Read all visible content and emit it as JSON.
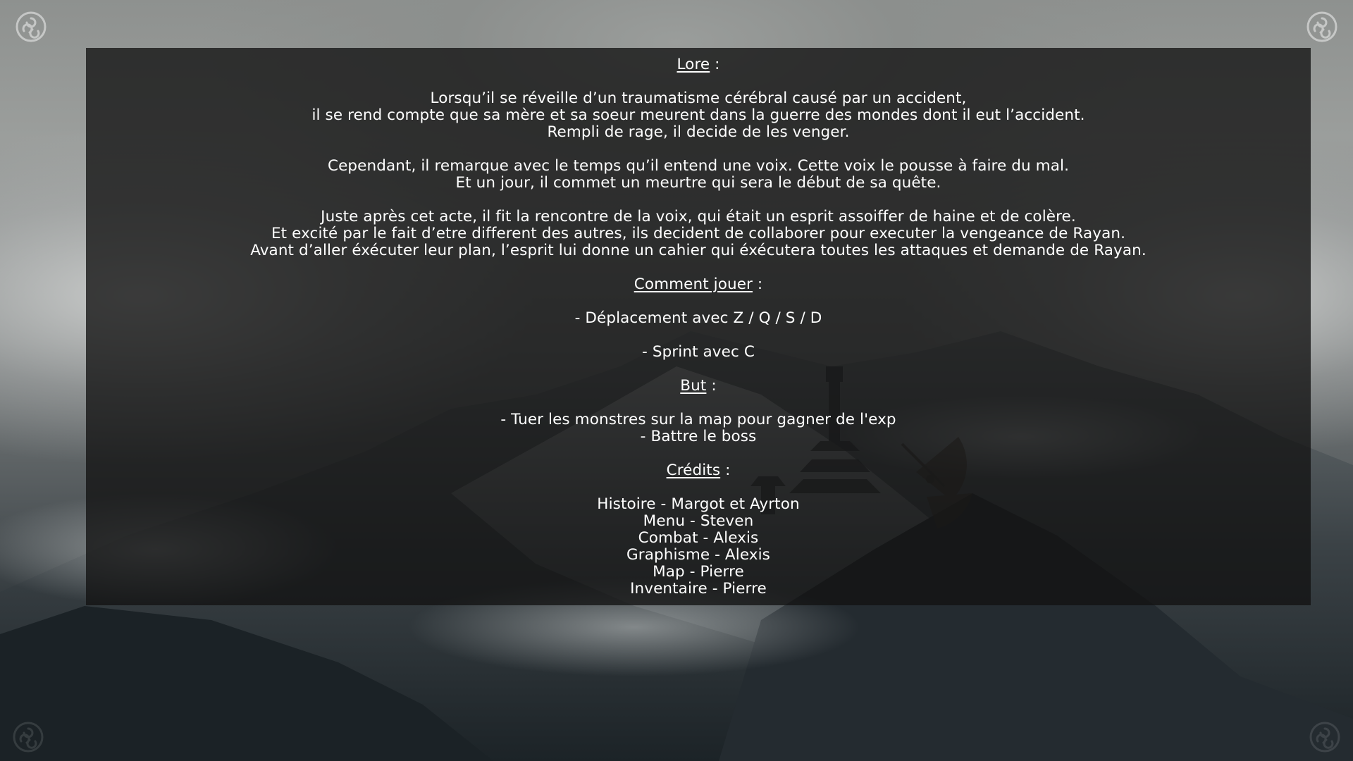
{
  "sections": {
    "lore": {
      "heading": "Lore",
      "suffix": " :",
      "paragraphs": [
        [
          "Lorsqu’il se réveille d’un traumatisme cérébral causé par un accident,",
          "il se rend compte que sa mère et sa soeur meurent dans la guerre des mondes dont il eut l’accident.",
          "Rempli de rage, il decide de les venger."
        ],
        [
          "Cependant, il remarque avec le temps qu’il entend une voix. Cette voix le pousse à faire du mal.",
          "Et un jour, il commet un meurtre qui sera le début de sa quête."
        ],
        [
          "Juste après cet acte, il fit la rencontre de la voix, qui était un esprit assoiffer de haine et de colère.",
          "Et excité par le fait d’etre different des autres, ils decident de collaborer pour executer la vengeance de Rayan.",
          "Avant d’aller éxécuter leur plan, l’esprit lui donne un cahier qui éxécutera toutes les attaques et demande de Rayan."
        ]
      ]
    },
    "how_to_play": {
      "heading": "Comment jouer",
      "suffix": " :",
      "items": [
        "- Déplacement avec Z / Q / S / D",
        "- Sprint avec C"
      ]
    },
    "goal": {
      "heading": "But",
      "suffix": " :",
      "items": [
        "- Tuer les monstres sur la map pour gagner de l'exp",
        "- Battre le boss"
      ]
    },
    "credits": {
      "heading": "Crédits",
      "suffix": " :",
      "items": [
        "Histoire - Margot et Ayrton",
        "Menu - Steven",
        "Combat - Alexis",
        "Graphisme - Alexis",
        "Map - Pierre",
        "Inventaire - Pierre"
      ]
    }
  },
  "icons": {
    "corner": "triskelion-icon",
    "fan": "fan-emblem-icon"
  },
  "colors": {
    "panel_bg": "#121212",
    "text": "#ffffff"
  }
}
